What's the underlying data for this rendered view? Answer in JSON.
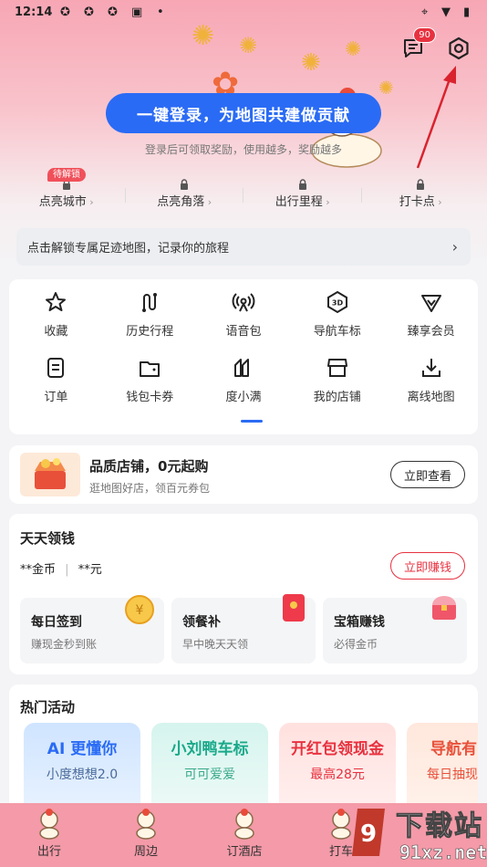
{
  "status_bar": {
    "time": "12:14"
  },
  "header": {
    "message_badge": "90",
    "login_button": "一键登录，为地图共建做贡献",
    "login_subtitle": "登录后可领取奖励，使用越多，奖励越多"
  },
  "quick_links": [
    {
      "label": "点亮城市",
      "tag": "待解锁"
    },
    {
      "label": "点亮角落"
    },
    {
      "label": "出行里程"
    },
    {
      "label": "打卡点"
    }
  ],
  "unlock_bar": {
    "text": "点击解锁专属足迹地图，记录你的旅程"
  },
  "grid": [
    {
      "label": "收藏",
      "icon": "star-icon"
    },
    {
      "label": "历史行程",
      "icon": "route-icon"
    },
    {
      "label": "语音包",
      "icon": "voice-icon"
    },
    {
      "label": "导航车标",
      "icon": "car-3d-icon"
    },
    {
      "label": "臻享会员",
      "icon": "diamond-icon"
    },
    {
      "label": "订单",
      "icon": "order-icon"
    },
    {
      "label": "钱包卡券",
      "icon": "wallet-icon"
    },
    {
      "label": "度小满",
      "icon": "duxiaoman-icon"
    },
    {
      "label": "我的店铺",
      "icon": "store-icon"
    },
    {
      "label": "离线地图",
      "icon": "download-icon"
    }
  ],
  "shop_banner": {
    "title": "品质店铺，0元起购",
    "subtitle": "逛地图好店，领百元券包",
    "button": "立即查看"
  },
  "daily_coins": {
    "title": "天天领钱",
    "coins": "**金币",
    "cash": "**元",
    "button": "立即赚钱",
    "tasks": [
      {
        "title": "每日签到",
        "subtitle": "赚现金秒到账"
      },
      {
        "title": "领餐补",
        "subtitle": "早中晚天天领"
      },
      {
        "title": "宝箱赚钱",
        "subtitle": "必得金币"
      }
    ]
  },
  "hot_activities": {
    "title": "热门活动",
    "cards": [
      {
        "title": "AI 更懂你",
        "subtitle": "小度想想2.0"
      },
      {
        "title": "小刘鸭车标",
        "subtitle": "可可爱爱"
      },
      {
        "title": "开红包领现金",
        "subtitle": "最高28元"
      },
      {
        "title": "导航有",
        "subtitle": "每日抽现"
      }
    ]
  },
  "tabbar": [
    {
      "label": "出行"
    },
    {
      "label": "周边"
    },
    {
      "label": "订酒店"
    },
    {
      "label": "打车"
    }
  ],
  "watermark": {
    "text": "下载站",
    "url_text": "91xz.net"
  }
}
